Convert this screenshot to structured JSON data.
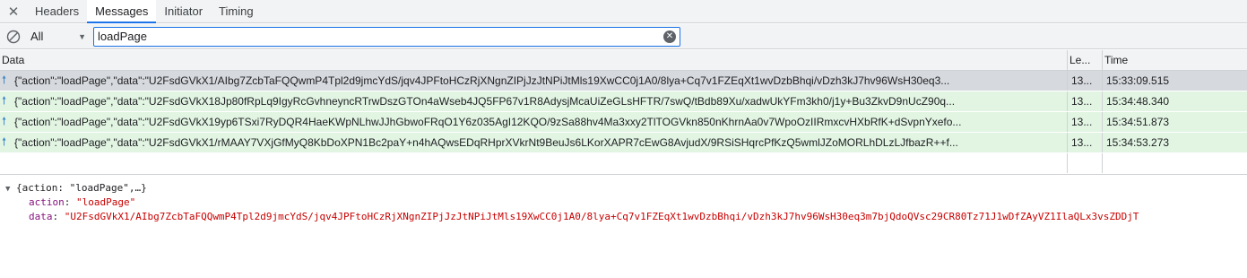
{
  "tabs": {
    "close_label": "✕",
    "items": [
      {
        "label": "Headers",
        "active": false
      },
      {
        "label": "Messages",
        "active": true
      },
      {
        "label": "Initiator",
        "active": false
      },
      {
        "label": "Timing",
        "active": false
      }
    ]
  },
  "filter": {
    "type_selected": "All",
    "search_value": "loadPage"
  },
  "table": {
    "headers": {
      "data": "Data",
      "length": "Le...",
      "time": "Time"
    },
    "rows": [
      {
        "data": "{\"action\":\"loadPage\",\"data\":\"U2FsdGVkX1/AIbg7ZcbTaFQQwmP4Tpl2d9jmcYdS/jqv4JPFtoHCzRjXNgnZIPjJzJtNPiJtMls19XwCC0j1A0/8lya+Cq7v1FZEqXt1wvDzbBhqi/vDzh3kJ7hv96WsH30eq3...",
        "length": "13...",
        "time": "15:33:09.515",
        "selected": true
      },
      {
        "data": "{\"action\":\"loadPage\",\"data\":\"U2FsdGVkX18Jp80fRpLq9IgyRcGvhneyncRTrwDszGTOn4aWseb4JQ5FP67v1R8AdysjMcaUiZeGLsHFTR/7swQ/tBdb89Xu/xadwUkYFm3kh0/j1y+Bu3ZkvD9nUcZ90q...",
        "length": "13...",
        "time": "15:34:48.340",
        "selected": false
      },
      {
        "data": "{\"action\":\"loadPage\",\"data\":\"U2FsdGVkX19yp6TSxi7RyDQR4HaeKWpNLhwJJhGbwoFRqO1Y6z035AgI12KQO/9zSa88hv4Ma3xxy2TlTOGVkn850nKhrnAa0v7WpoOzIIRmxcvHXbRfK+dSvpnYxefo...",
        "length": "13...",
        "time": "15:34:51.873",
        "selected": false
      },
      {
        "data": "{\"action\":\"loadPage\",\"data\":\"U2FsdGVkX1/rMAAY7VXjGfMyQ8KbDoXPN1Bc2paY+n4hAQwsEDqRHprXVkrNt9BeuJs6LKorXAPR7cEwG8AvjudX/9RSiSHqrcPfKzQ5wmlJZoMORLhDLzLJfbazR++f...",
        "length": "13...",
        "time": "15:34:53.273",
        "selected": false
      }
    ]
  },
  "detail": {
    "summary": "{action: \"loadPage\",…}",
    "action_key": "action",
    "action_value": "\"loadPage\"",
    "data_key": "data",
    "data_value": "\"U2FsdGVkX1/AIbg7ZcbTaFQQwmP4Tpl2d9jmcYdS/jqv4JPFtoHCzRjXNgnZIPjJzJtNPiJtMls19XwCC0j1A0/8lya+Cq7v1FZEqXt1wvDzbBhqi/vDzh3kJ7hv96WsH30eq3m7bjQdoQVsc29CR80Tz71J1wDfZAyVZ1IlaQLx3vsZDDjT"
  },
  "colors": {
    "accent": "#1a73e8",
    "row_green": "#e2f5e3",
    "row_selected": "#d6d9dd",
    "json_key": "#881280",
    "json_string": "#c80000"
  },
  "icons": {
    "close": "close-icon",
    "block": "block-icon",
    "upload_arrow": "arrow-up-icon",
    "clear": "clear-search-icon"
  }
}
